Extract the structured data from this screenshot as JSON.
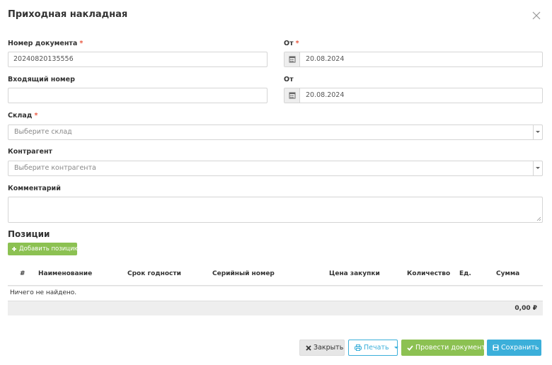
{
  "modal": {
    "title": "Приходная накладная"
  },
  "form": {
    "doc_number": {
      "label": "Номер документа",
      "required": "*",
      "value": "20240820135556"
    },
    "doc_date": {
      "label": "От",
      "required": "*",
      "value": "20.08.2024"
    },
    "incoming_number": {
      "label": "Входящий номер",
      "value": ""
    },
    "incoming_date": {
      "label": "От",
      "value": "20.08.2024"
    },
    "warehouse": {
      "label": "Склад",
      "required": "*",
      "placeholder": "Выберите склад"
    },
    "counterparty": {
      "label": "Контрагент",
      "placeholder": "Выберите контрагента"
    },
    "comment": {
      "label": "Комментарий",
      "value": ""
    }
  },
  "positions": {
    "title": "Позиции",
    "add_button": "Добавить позицию",
    "columns": [
      "#",
      "Наименование",
      "Срок годности",
      "Серийный номер",
      "Цена закупки",
      "Количество",
      "Ед.",
      "Сумма"
    ],
    "empty_text": "Ничего не найдено.",
    "total": "0,00 ₽"
  },
  "footer": {
    "close_label": "Закрыть",
    "print_label": "Печать",
    "post_label": "Провести документ",
    "save_label": "Сохранить"
  },
  "colors": {
    "primary": "#3bafda",
    "success": "#8cc152",
    "required": "#e9573f",
    "border": "#d5d5d5"
  },
  "icons": [
    "close-icon",
    "calendar-icon",
    "plus-icon",
    "times-icon",
    "print-icon",
    "check-icon",
    "save-icon"
  ]
}
